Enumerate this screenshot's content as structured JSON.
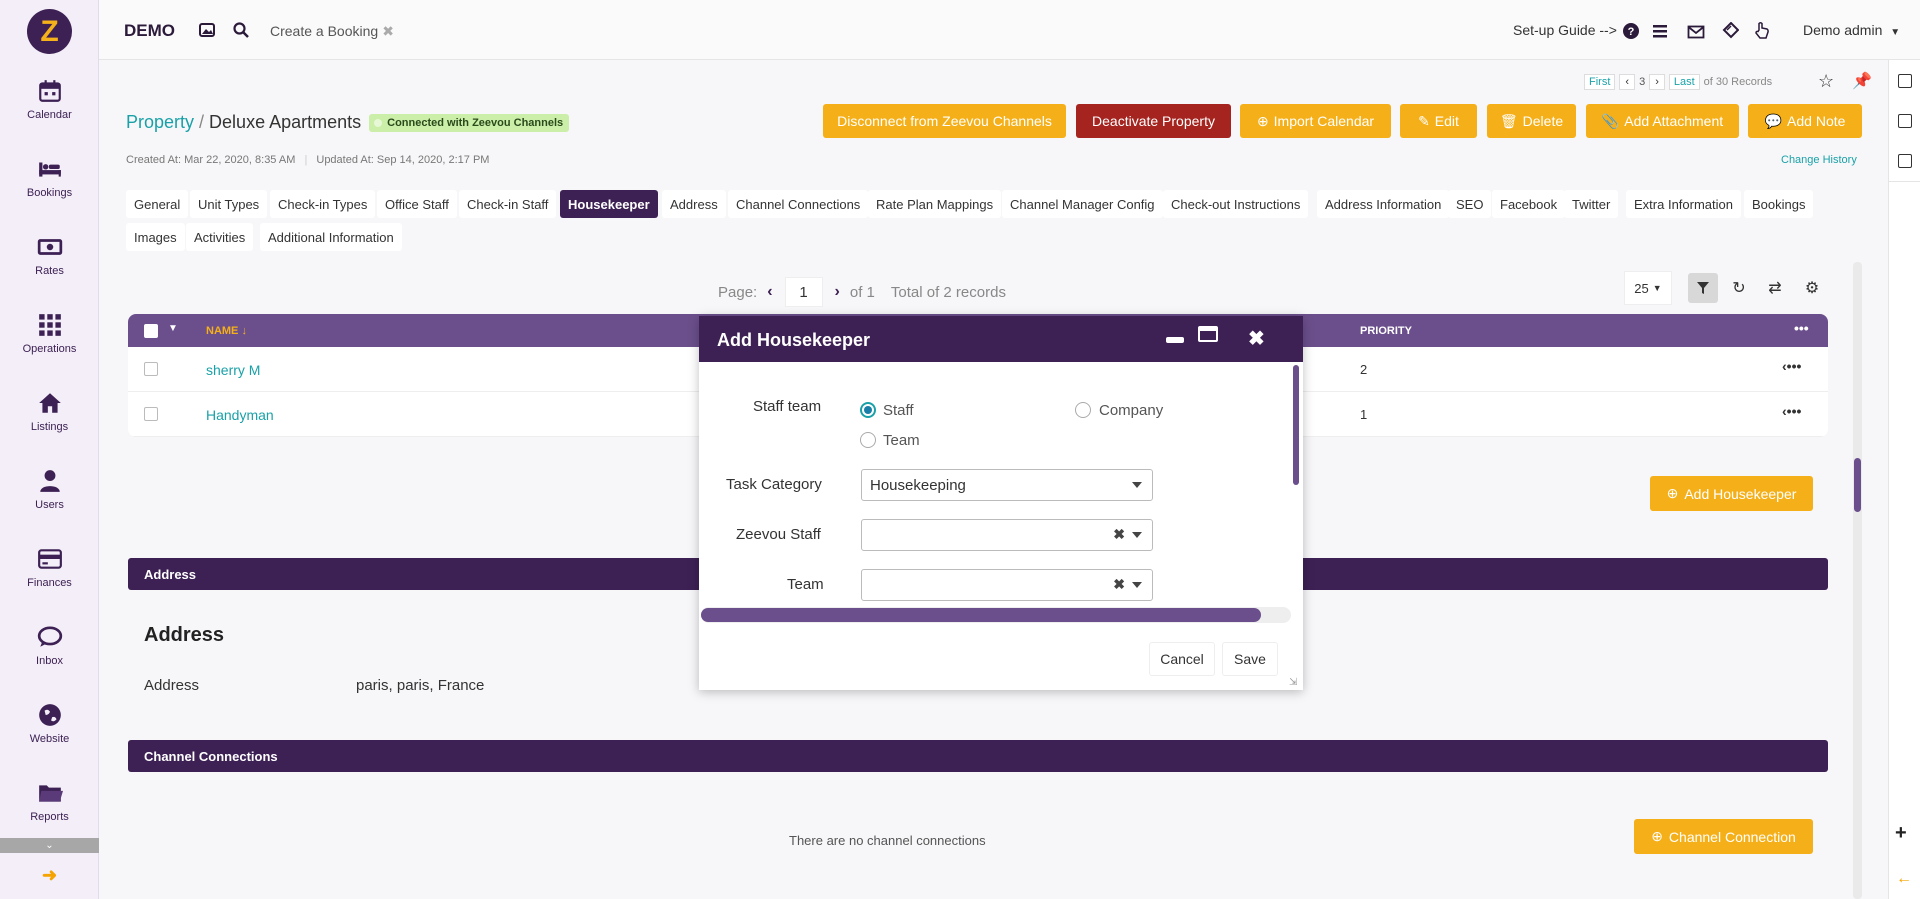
{
  "sidebar": {
    "items": [
      {
        "label": "Calendar",
        "icon": "calendar-icon"
      },
      {
        "label": "Bookings",
        "icon": "bed-icon"
      },
      {
        "label": "Rates",
        "icon": "money-icon"
      },
      {
        "label": "Operations",
        "icon": "grid-icon"
      },
      {
        "label": "Listings",
        "icon": "home-icon"
      },
      {
        "label": "Users",
        "icon": "user-icon"
      },
      {
        "label": "Finances",
        "icon": "credit-card-icon"
      },
      {
        "label": "Inbox",
        "icon": "chat-icon"
      },
      {
        "label": "Website",
        "icon": "globe-icon"
      },
      {
        "label": "Reports",
        "icon": "folder-icon"
      }
    ]
  },
  "topbar": {
    "brand": "DEMO",
    "tab_label": "Create a Booking",
    "tab_close": "✖",
    "setup_guide": "Set-up Guide -->",
    "user": "Demo admin"
  },
  "record_pager": {
    "first": "First",
    "current": "3",
    "last": "Last",
    "total": "of 30 Records"
  },
  "breadcrumb": {
    "parent": "Property",
    "separator": "/",
    "current": "Deluxe Apartments",
    "badge": "Connected with Zeevou Channels"
  },
  "actions": [
    {
      "label": "Disconnect from Zeevou Channels",
      "style": "yellow"
    },
    {
      "label": "Deactivate Property",
      "style": "red"
    },
    {
      "label": "Import Calendar",
      "style": "yellow"
    },
    {
      "label": "Edit",
      "style": "yellow"
    },
    {
      "label": "Delete",
      "style": "yellow"
    },
    {
      "label": "Add Attachment",
      "style": "yellow"
    },
    {
      "label": "Add Note",
      "style": "yellow"
    }
  ],
  "meta": {
    "created": "Created At: Mar 22, 2020, 8:35 AM",
    "updated": "Updated At: Sep 14, 2020, 2:17 PM",
    "change_history": "Change History"
  },
  "tabs": [
    "General",
    "Unit Types",
    "Check-in Types",
    "Office Staff",
    "Check-in Staff",
    "Housekeeper",
    "Address",
    "Channel Connections",
    "Rate Plan Mappings",
    "Channel Manager Config",
    "Check-out Instructions",
    "Address Information",
    "SEO",
    "Facebook",
    "Twitter",
    "Extra Information",
    "Bookings",
    "Images",
    "Activities",
    "Additional Information"
  ],
  "active_tab": "Housekeeper",
  "list_pager": {
    "page_label": "Page:",
    "page": "1",
    "of": "of 1",
    "total": "Total of 2 records",
    "per_page": "25"
  },
  "grid": {
    "col_name": "NAME",
    "col_priority": "PRIORITY",
    "rows": [
      {
        "name": "sherry M",
        "priority": "2"
      },
      {
        "name": "Handyman",
        "priority": "1"
      }
    ]
  },
  "add_housekeeper_btn": "Add Housekeeper",
  "address_section": {
    "bar": "Address",
    "title": "Address",
    "label": "Address",
    "value": "paris, paris, France"
  },
  "channel_section": {
    "bar": "Channel Connections",
    "empty": "There are no channel connections",
    "button": "Channel Connection"
  },
  "modal": {
    "title": "Add Housekeeper",
    "staff_team_label": "Staff team",
    "radio_staff": "Staff",
    "radio_company": "Company",
    "radio_team": "Team",
    "selected_radio": "Staff",
    "task_category_label": "Task Category",
    "task_category_value": "Housekeeping",
    "zeevou_staff_label": "Zeevou Staff",
    "zeevou_staff_value": "",
    "team_label": "Team",
    "team_value": "",
    "cancel": "Cancel",
    "save": "Save"
  },
  "colors": {
    "brand_purple": "#3d2154",
    "header_purple": "#6b4f8c",
    "accent_yellow": "#f5b019",
    "danger_red": "#a5241f",
    "link_teal": "#1aa1a8"
  }
}
